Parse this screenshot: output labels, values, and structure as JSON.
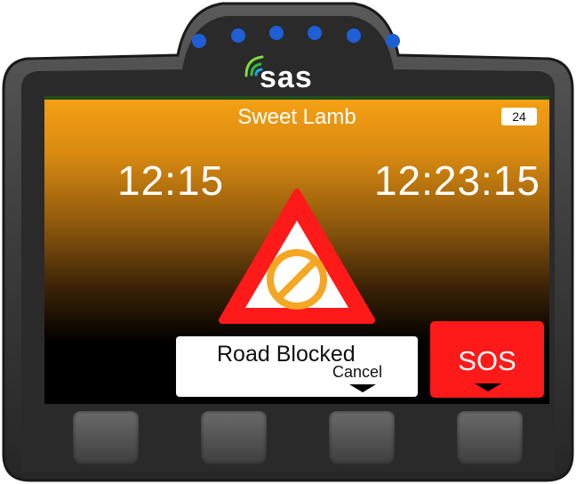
{
  "device": {
    "brand_logo_text": "sas",
    "led_color": "#1e5fd6",
    "led_count": 6,
    "hardware_button_count": 4
  },
  "screen": {
    "title": "Sweet Lamb",
    "badge": "24",
    "time_left": "12:15",
    "time_right": "12:23:15",
    "warning_icon": "road-blocked-warning-icon",
    "road_label": "Road Blocked",
    "cancel_label": "Cancel",
    "sos_label": "SOS"
  },
  "colors": {
    "screen_gradient_top": "#f4a014",
    "warning_red": "#ff1a1a",
    "warning_orange": "#f5a623",
    "sos_red": "#ff1a1a"
  }
}
